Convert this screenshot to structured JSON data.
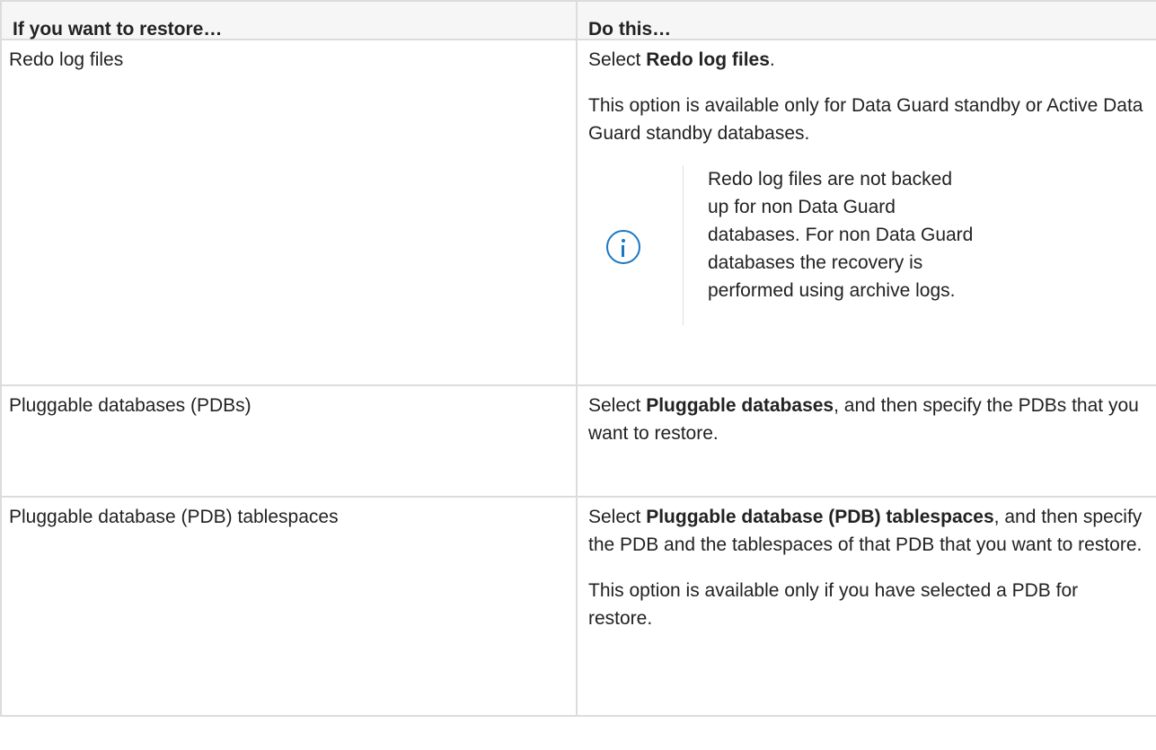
{
  "header": {
    "col1": "If you want to restore…",
    "col2": "Do this…"
  },
  "rows": [
    {
      "item": "Redo log files",
      "action_prefix": "Select ",
      "action_bold": "Redo log files",
      "action_suffix": ".",
      "availability": "This option is available only for Data Guard standby or Active Data Guard standby databases.",
      "note": {
        "icon": "info-icon",
        "text": "Redo log files are not backed up for non Data Guard databases. For non Data Guard databases the recovery is performed using archive logs."
      }
    },
    {
      "item": "Pluggable databases (PDBs)",
      "action_prefix": "Select ",
      "action_bold": "Pluggable databases",
      "action_suffix": ", and then specify the PDBs that you want to restore."
    },
    {
      "item": "Pluggable database (PDB) tablespaces",
      "action_prefix": "Select ",
      "action_bold": "Pluggable database (PDB) tablespaces",
      "action_suffix": ", and then specify the PDB and the tablespaces of that PDB that you want to restore.",
      "availability": "This option is available only if you have selected a PDB for restore."
    }
  ],
  "colors": {
    "border": "#dcdcdc",
    "header_bg": "#f6f6f6",
    "info_icon": "#1a78c2"
  }
}
